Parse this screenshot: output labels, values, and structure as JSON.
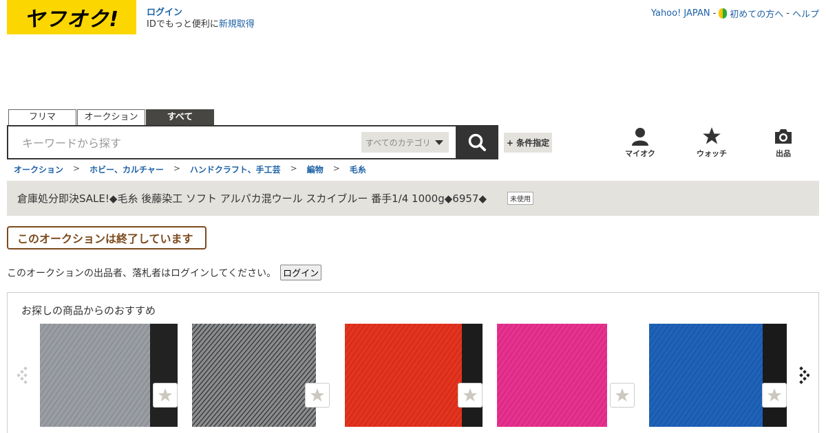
{
  "header": {
    "logo": "ヤフオク!",
    "login_link": "ログイン",
    "login_promo": "IDでもっと便利に",
    "signup_link": "新規取得",
    "yahoo_link": "Yahoo! JAPAN",
    "beginner_link": "初めての方へ",
    "help_link": "ヘルプ",
    "sep": "-"
  },
  "tabs": [
    {
      "label": "フリマ",
      "active": false
    },
    {
      "label": "オークション",
      "active": false
    },
    {
      "label": "すべて",
      "active": true
    }
  ],
  "search": {
    "placeholder": "キーワードから探す",
    "category": "すべてのカテゴリ",
    "condition_button": "+ 条件指定"
  },
  "nav": {
    "myauc": "マイオク",
    "watch": "ウォッチ",
    "sell": "出品"
  },
  "breadcrumb": [
    "オークション",
    "ホビー、カルチャー",
    "ハンドクラフト、手工芸",
    "編物",
    "毛糸"
  ],
  "breadcrumb_sep": ">",
  "item": {
    "title": "倉庫処分即決SALE!◆毛糸 後藤染工 ソフト アルパカ混ウール スカイブルー 番手1/4 1000g◆6957◆",
    "condition": "未使用",
    "ended_label": "このオークションは終了しています",
    "login_notice": "このオークションの出品者、落札者はログインしてください。",
    "login_button": "ログイン"
  },
  "recommendations": {
    "title": "お探しの商品からのおすすめ",
    "items": [
      {
        "color": "#9a9ea3",
        "accent": "#7f848a"
      },
      {
        "color": "#6e7072",
        "accent": "#3f4143"
      },
      {
        "color": "#e3341f",
        "accent": "#c0200e"
      },
      {
        "color": "#e6328f",
        "accent": "#c21c73"
      },
      {
        "color": "#1f62b8",
        "accent": "#134b94"
      }
    ]
  },
  "colors": {
    "brand_yellow": "#fcd600",
    "link": "#1d61a6",
    "dark": "#333333",
    "banner": "#e4e2dd",
    "ended": "#7c4a1c"
  }
}
